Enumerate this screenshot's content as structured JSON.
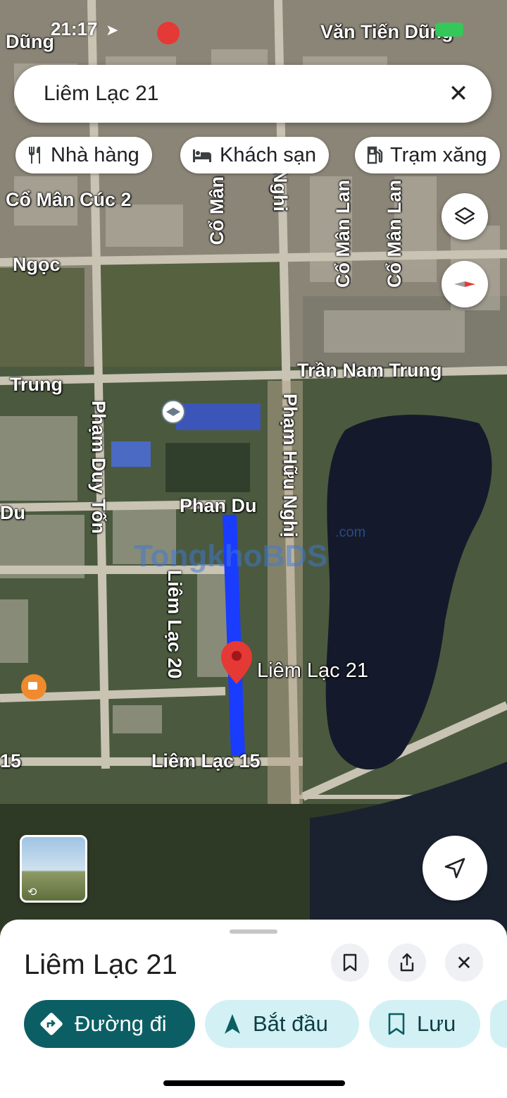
{
  "status_bar": {
    "time": "21:17"
  },
  "search": {
    "query": "Liêm Lạc 21"
  },
  "chips": [
    {
      "icon": "restaurant-icon",
      "label": "Nhà hàng"
    },
    {
      "icon": "hotel-icon",
      "label": "Khách sạn"
    },
    {
      "icon": "gas-station-icon",
      "label": "Trạm xăng"
    }
  ],
  "map": {
    "labels": {
      "dung": "Dũng",
      "van_tien_dung": "Văn Tiến Dũng",
      "co_man_cuc_2": "Cổ Mân Cúc 2",
      "ngoc": "Ngọc",
      "co_man": "Cổ Mân",
      "nghi_top": "Nghi",
      "co_man_lan_a": "Cổ Mân Lan",
      "co_man_lan_b": "Cổ Mân Lan",
      "tran_nam_trung": "Trần Nam Trung",
      "trung_left": "Trung",
      "pham_huu_nghi": "Phạm Hữu Nghị",
      "pham_duy_ton": "Phạm Duy Tốn",
      "phan_du": "Phan Du",
      "du_left": "Du",
      "liem_lac_20": "Liêm Lạc 20",
      "liem_lac_21": "Liêm Lạc 21",
      "liem_lac_15": "Liêm Lạc 15",
      "num_15": "15"
    },
    "watermark": "TongkhoBDS",
    "watermark_suffix": ".com",
    "colors": {
      "route": "#1a3cff",
      "pin": "#e53935",
      "water": "#141a2b"
    }
  },
  "sheet": {
    "title": "Liêm Lạc 21",
    "actions": [
      {
        "icon": "directions-icon",
        "label": "Đường đi",
        "style": "primary"
      },
      {
        "icon": "navigation-arrow-icon",
        "label": "Bắt đầu",
        "style": "secondary"
      },
      {
        "icon": "bookmark-icon",
        "label": "Lưu",
        "style": "secondary"
      }
    ]
  }
}
